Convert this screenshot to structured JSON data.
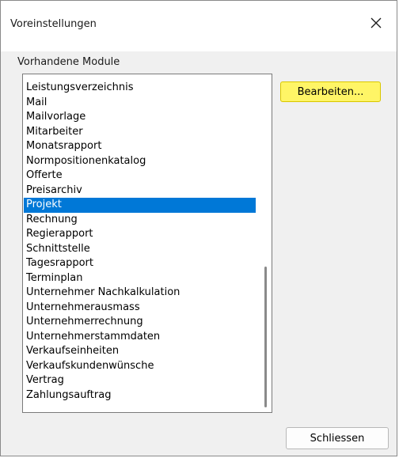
{
  "window": {
    "title": "Voreinstellungen",
    "close_icon": "close-icon"
  },
  "modules": {
    "label": "Vorhandene Module",
    "items": [
      "Leistungsverzeichnis",
      "Mail",
      "Mailvorlage",
      "Mitarbeiter",
      "Monatsrapport",
      "Normpositionenkatalog",
      "Offerte",
      "Preisarchiv",
      "Projekt",
      "Rechnung",
      "Regierapport",
      "Schnittstelle",
      "Tagesrapport",
      "Terminplan",
      "Unternehmer Nachkalkulation",
      "Unternehmerausmass",
      "Unternehmerrechnung",
      "Unternehmerstammdaten",
      "Verkaufseinheiten",
      "Verkaufskundenwünsche",
      "Vertrag",
      "Zahlungsauftrag"
    ],
    "selected": "Projekt"
  },
  "buttons": {
    "edit": "Bearbeiten...",
    "close": "Schliessen"
  },
  "colors": {
    "selection": "#0078d7",
    "edit_button": "#fff566"
  }
}
